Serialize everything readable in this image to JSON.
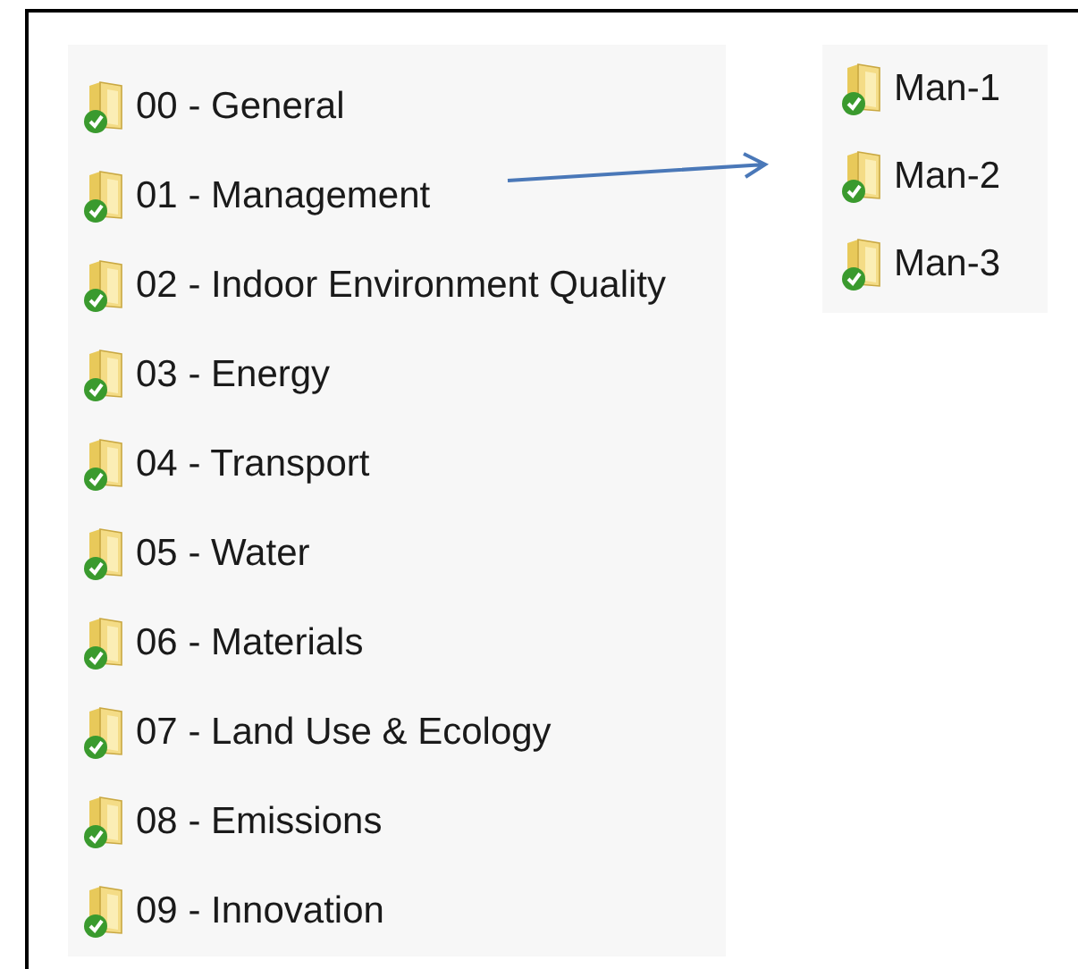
{
  "folders": [
    {
      "name": "00 - General",
      "synced": true
    },
    {
      "name": "01 - Management",
      "synced": true
    },
    {
      "name": "02 - Indoor Environment Quality",
      "synced": true
    },
    {
      "name": "03 - Energy",
      "synced": true
    },
    {
      "name": "04 - Transport",
      "synced": true
    },
    {
      "name": "05 - Water",
      "synced": true
    },
    {
      "name": "06 - Materials",
      "synced": true
    },
    {
      "name": "07 - Land Use & Ecology",
      "synced": true
    },
    {
      "name": "08 - Emissions",
      "synced": true
    },
    {
      "name": "09 - Innovation",
      "synced": true
    }
  ],
  "subfolders": [
    {
      "name": "Man-1",
      "synced": true
    },
    {
      "name": "Man-2",
      "synced": true
    },
    {
      "name": "Man-3",
      "synced": true
    }
  ]
}
